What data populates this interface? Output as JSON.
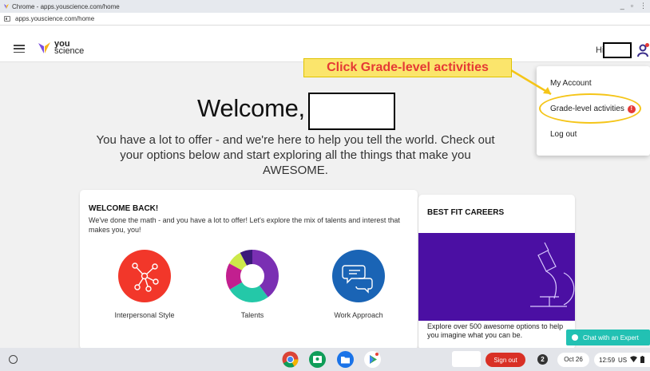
{
  "window": {
    "title": "Chrome - apps.youscience.com/home",
    "minimize": "_",
    "restore": "▫",
    "more": "⋮"
  },
  "address": {
    "url": "apps.youscience.com/home"
  },
  "header": {
    "logo_line1": "you",
    "logo_line2": "science",
    "greeting": "Hi"
  },
  "welcome": {
    "title": "Welcome,",
    "subtitle": "You have a lot to offer - and we're here to help you tell the world. Check out your options below and start exploring all the things that make you AWESOME."
  },
  "welcome_card": {
    "title": "WELCOME BACK!",
    "body": "We've done the math - and you have a lot to offer! Let's explore the mix of talents and interest that makes you, you!",
    "categories": [
      {
        "label": "Interpersonal Style",
        "icon": "network-icon",
        "color": "#f2372a"
      },
      {
        "label": "Talents",
        "icon": "donut-chart-icon",
        "color": "#7a2fb3"
      },
      {
        "label": "Work Approach",
        "icon": "chat-bubbles-icon",
        "color": "#1a64b5"
      }
    ]
  },
  "careers_card": {
    "title": "BEST FIT CAREERS",
    "body": "Explore over 500 awesome options to help you imagine what you can be.",
    "banner_color": "#4b0fa3"
  },
  "chat": {
    "label": "Chat with an Expert"
  },
  "dropdown": {
    "items": [
      {
        "label": "My Account"
      },
      {
        "label": "Grade-level activities",
        "badge": "!"
      },
      {
        "label": "Log out"
      }
    ]
  },
  "annotation": {
    "text": "Click Grade-level activities"
  },
  "shelf": {
    "signout": "Sign out",
    "notification_count": "2",
    "date": "Oct 26",
    "time": "12:59",
    "locale": "US"
  },
  "colors": {
    "accent_teal": "#22c1b3",
    "highlight_yellow": "#f5c518",
    "annotation_red": "#e53935"
  }
}
